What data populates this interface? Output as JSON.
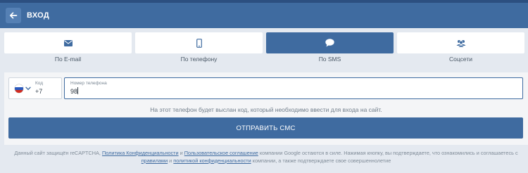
{
  "header": {
    "title": "ВХОД"
  },
  "tabs": [
    {
      "label": "По E-mail",
      "icon": "envelope-icon",
      "active": false
    },
    {
      "label": "По телефону",
      "icon": "phone-icon",
      "active": false
    },
    {
      "label": "По SMS",
      "icon": "chat-bubble-icon",
      "active": true
    },
    {
      "label": "Соцсети",
      "icon": "users-icon",
      "active": false
    }
  ],
  "form": {
    "country": {
      "flag": "russia-flag-icon",
      "code_label": "Код",
      "code_value": "+7"
    },
    "phone": {
      "label": "Номер телефона",
      "value": "98"
    },
    "hint": "На этот телефон будет выслан код, который необходимо ввести для входа на сайт.",
    "submit_label": "ОТПРАВИТЬ СМС"
  },
  "disclaimer": {
    "t1": "Данный сайт защищён reCAPTCHA, ",
    "link1": "Политика Конфиденциальности",
    "t2": " и ",
    "link2": "Пользовательское соглашение",
    "t3": " компании Google остаются в силе.  Нажимая кнопку, вы подтверждаете, что ознакомились и соглашаетесь с ",
    "link3": "правилами",
    "t4": " и ",
    "link4": "политикой конфиденциальности",
    "t5": " компании, а также подтверждаете свое совершеннолетие"
  },
  "colors": {
    "primary": "#3f6ba0",
    "header_dark": "#2c4f80",
    "background": "#e4e9f0",
    "panel": "#f4f5f7"
  }
}
